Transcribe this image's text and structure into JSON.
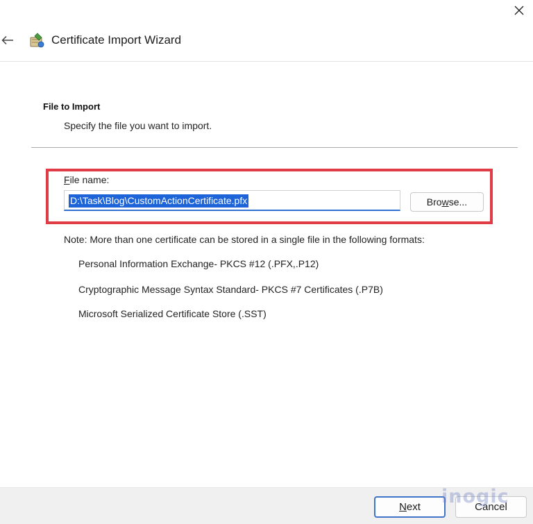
{
  "window": {
    "title": "Certificate Import Wizard"
  },
  "header": {
    "section_title": "File to Import",
    "section_subtitle": "Specify the file you want to import."
  },
  "file": {
    "label_accel": "F",
    "label_rest": "ile name:",
    "value": "D:\\Task\\Blog\\CustomActionCertificate.pfx",
    "browse_accel": "w",
    "browse_before": "Bro",
    "browse_after": "se..."
  },
  "notes": {
    "intro": "Note:  More than one certificate can be stored in a single file in the following formats:",
    "formats": [
      "Personal Information Exchange- PKCS #12 (.PFX,.P12)",
      "Cryptographic Message Syntax Standard- PKCS #7 Certificates (.P7B)",
      "Microsoft Serialized Certificate Store (.SST)"
    ]
  },
  "footer": {
    "next_accel": "N",
    "next_rest": "ext",
    "cancel_label": "Cancel"
  },
  "watermark": "inogic",
  "colors": {
    "highlight": "#e03c45",
    "selection": "#1d64d8",
    "accent": "#3f74c9"
  }
}
